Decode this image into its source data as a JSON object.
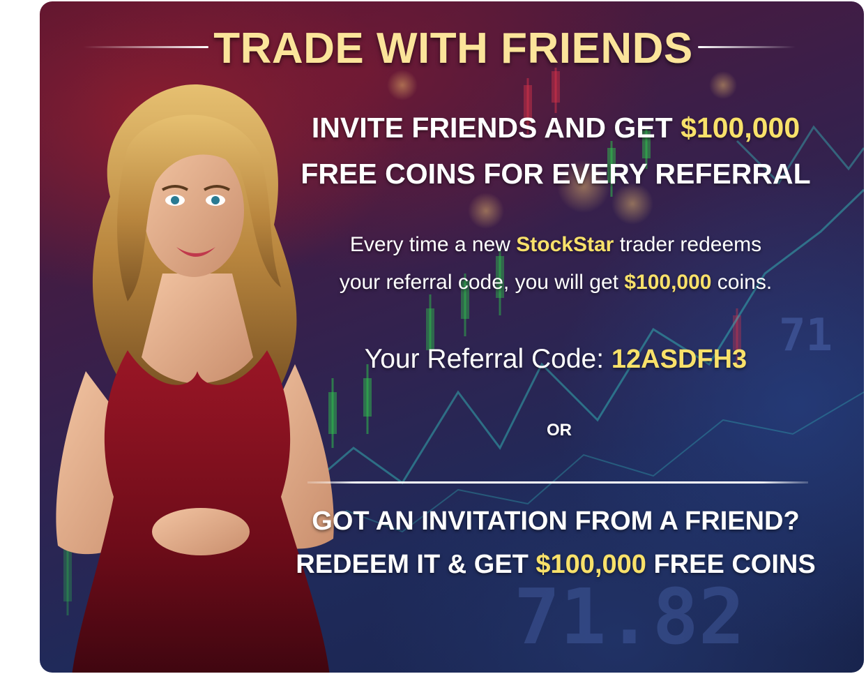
{
  "title": "TRADE WITH FRIENDS",
  "invite": {
    "line1_prefix": "INVITE FRIENDS AND GET ",
    "line1_amount": "$100,000",
    "line2": "FREE COINS FOR EVERY REFERRAL"
  },
  "description": {
    "part1": "Every time a new ",
    "brand": "StockStar",
    "part2": " trader redeems",
    "part3": "your referral code, you will get ",
    "amount": "$100,000",
    "part4": " coins."
  },
  "referral": {
    "label": "Your Referral Code: ",
    "code": "12ASDFH3"
  },
  "or_label": "OR",
  "redeem": {
    "line1": "GOT AN INVITATION FROM A FRIEND?",
    "line2_prefix": "REDEEM IT & GET ",
    "line2_amount": "$100,000",
    "line2_suffix": " FREE COINS"
  },
  "background_numbers": [
    "71",
    "71.82"
  ],
  "colors": {
    "title_gold": "#fbe49a",
    "highlight_gold": "#f8e16a",
    "text_white": "#ffffff",
    "dress_red": "#7a0f1c"
  },
  "icons": {
    "character": "hostess-character-illustration"
  }
}
